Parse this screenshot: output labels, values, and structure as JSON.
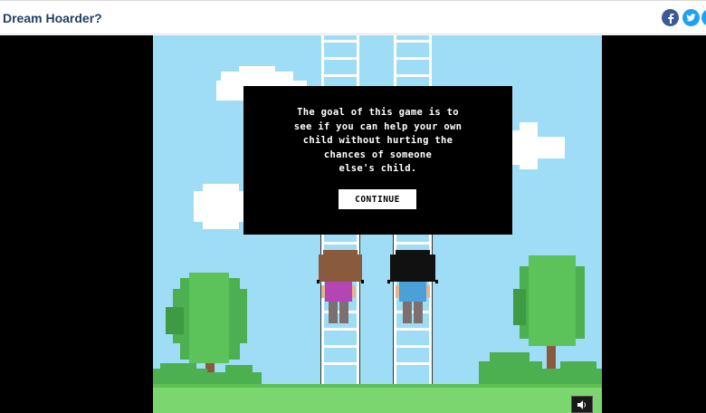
{
  "header": {
    "title": "Dream Hoarder?",
    "share_icons": [
      "facebook-icon",
      "twitter-icon",
      "share-more-icon"
    ]
  },
  "colors": {
    "header_title": "#1f3f66",
    "sky": "#9fdcf5",
    "grass": "#7bd66f",
    "dialog_bg": "#000000",
    "dialog_text": "#ffffff",
    "facebook": "#3b5998",
    "twitter": "#1da1f2"
  },
  "dialog": {
    "message": "The goal of this game is to\nsee if you can help your own\nchild without hurting the\nchances of someone\nelse's child.",
    "continue_label": "CONTINUE"
  },
  "controls": {
    "sound_icon": "speaker-icon"
  }
}
